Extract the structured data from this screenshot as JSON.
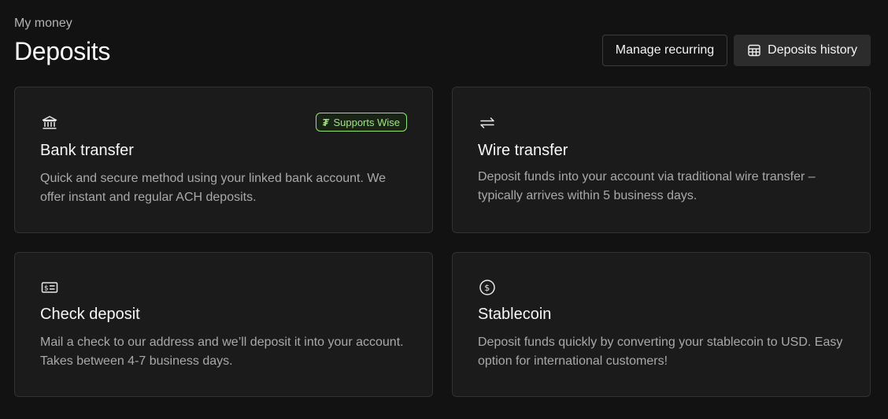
{
  "header": {
    "breadcrumb": "My money",
    "title": "Deposits",
    "manage_recurring_label": "Manage recurring",
    "deposits_history_label": "Deposits history"
  },
  "cards": [
    {
      "icon": "bank-icon",
      "title": "Bank transfer",
      "description": "Quick and secure method using your linked bank account. We offer instant and regular ACH deposits.",
      "badge": {
        "icon": "wise-icon",
        "label": "Supports Wise"
      }
    },
    {
      "icon": "transfer-arrows-icon",
      "title": "Wire transfer",
      "description": "Deposit funds into your account via traditional wire transfer – typically arrives within 5 business days."
    },
    {
      "icon": "check-icon",
      "title": "Check deposit",
      "description": "Mail a check to our address and we’ll deposit it into your account. Takes between 4-7 business days."
    },
    {
      "icon": "dollar-coin-icon",
      "title": "Stablecoin",
      "description": "Deposit funds quickly by converting your stablecoin to USD. Easy option for international customers!"
    }
  ],
  "colors": {
    "background": "#121212",
    "card": "#1b1b1b",
    "badge_accent": "#9be97a"
  }
}
